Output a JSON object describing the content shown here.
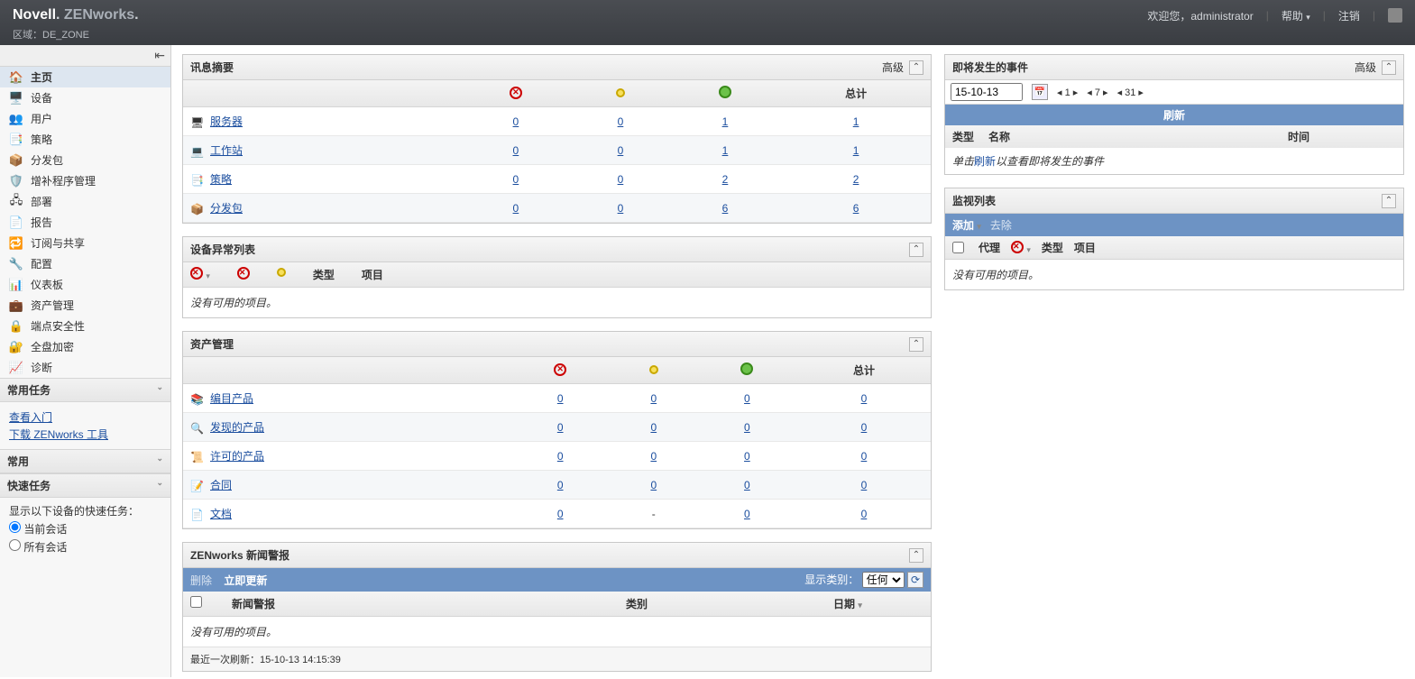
{
  "header": {
    "brand_left": "Novell",
    "brand_right": "ZENworks",
    "zone_prefix": "区域：",
    "zone_name": "DE_ZONE",
    "welcome": "欢迎您，",
    "user": "administrator",
    "help": "帮助",
    "logout": "注销"
  },
  "nav": [
    {
      "icon": "🏠",
      "label": "主页",
      "active": true
    },
    {
      "icon": "🖥️",
      "label": "设备"
    },
    {
      "icon": "👥",
      "label": "用户"
    },
    {
      "icon": "📑",
      "label": "策略"
    },
    {
      "icon": "📦",
      "label": "分发包"
    },
    {
      "icon": "🛡️",
      "label": "增补程序管理"
    },
    {
      "icon": "🖧",
      "label": "部署"
    },
    {
      "icon": "📄",
      "label": "报告"
    },
    {
      "icon": "🔁",
      "label": "订阅与共享"
    },
    {
      "icon": "🔧",
      "label": "配置"
    },
    {
      "icon": "📊",
      "label": "仪表板"
    },
    {
      "icon": "💼",
      "label": "资产管理"
    },
    {
      "icon": "🔒",
      "label": "端点安全性"
    },
    {
      "icon": "🔐",
      "label": "全盘加密"
    },
    {
      "icon": "📈",
      "label": "诊断"
    }
  ],
  "side_common_tasks": {
    "title": "常用任务",
    "links": [
      "查看入门",
      "下载 ZENworks 工具"
    ]
  },
  "side_common": {
    "title": "常用"
  },
  "side_quick": {
    "title": "快速任务",
    "desc": "显示以下设备的快速任务：",
    "opt1": "当前会话",
    "opt2": "所有会话"
  },
  "summary": {
    "title": "讯息摘要",
    "advanced": "高级",
    "total": "总计",
    "rows": [
      {
        "icon": "🖥",
        "name": "服务器",
        "v": [
          "0",
          "0",
          "1",
          "1"
        ]
      },
      {
        "icon": "💻",
        "name": "工作站",
        "v": [
          "0",
          "0",
          "1",
          "1"
        ]
      },
      {
        "icon": "📑",
        "name": "策略",
        "v": [
          "0",
          "0",
          "2",
          "2"
        ]
      },
      {
        "icon": "📦",
        "name": "分发包",
        "v": [
          "0",
          "0",
          "6",
          "6"
        ]
      }
    ]
  },
  "hotlist": {
    "title": "设备异常列表",
    "cols": [
      "类型",
      "项目"
    ],
    "empty": "没有可用的项目。"
  },
  "asset": {
    "title": "资产管理",
    "total": "总计",
    "rows": [
      {
        "icon": "📚",
        "name": "编目产品",
        "v": [
          "0",
          "0",
          "0",
          "0"
        ]
      },
      {
        "icon": "🔍",
        "name": "发现的产品",
        "v": [
          "0",
          "0",
          "0",
          "0"
        ]
      },
      {
        "icon": "📜",
        "name": "许可的产品",
        "v": [
          "0",
          "0",
          "0",
          "0"
        ]
      },
      {
        "icon": "📝",
        "name": "合同",
        "v": [
          "0",
          "0",
          "0",
          "0"
        ]
      },
      {
        "icon": "📄",
        "name": "文档",
        "v": [
          "0",
          "-",
          "0",
          "0"
        ]
      }
    ]
  },
  "news": {
    "title": "ZENworks 新闻警报",
    "delete": "删除",
    "update_now": "立即更新",
    "show_cat": "显示类别：",
    "any": "任何",
    "col_alert": "新闻警报",
    "col_cat": "类别",
    "col_date": "日期",
    "empty": "没有可用的项目。",
    "last_refresh_label": "最近一次刷新：",
    "last_refresh_time": "15-10-13 14:15:39"
  },
  "events": {
    "title": "即将发生的事件",
    "advanced": "高级",
    "date": "15-10-13",
    "pager": [
      "◂ 1 ▸",
      "◂ 7 ▸",
      "◂ 31 ▸"
    ],
    "refresh": "刷新",
    "col_type": "类型",
    "col_name": "名称",
    "col_time": "时间",
    "hint_prefix": "单击",
    "hint_link": "刷新",
    "hint_suffix": "以查看即将发生的事件"
  },
  "watch": {
    "title": "监视列表",
    "add": "添加",
    "remove": "去除",
    "col_agent": "代理",
    "col_type": "类型",
    "col_item": "项目",
    "empty": "没有可用的项目。"
  }
}
